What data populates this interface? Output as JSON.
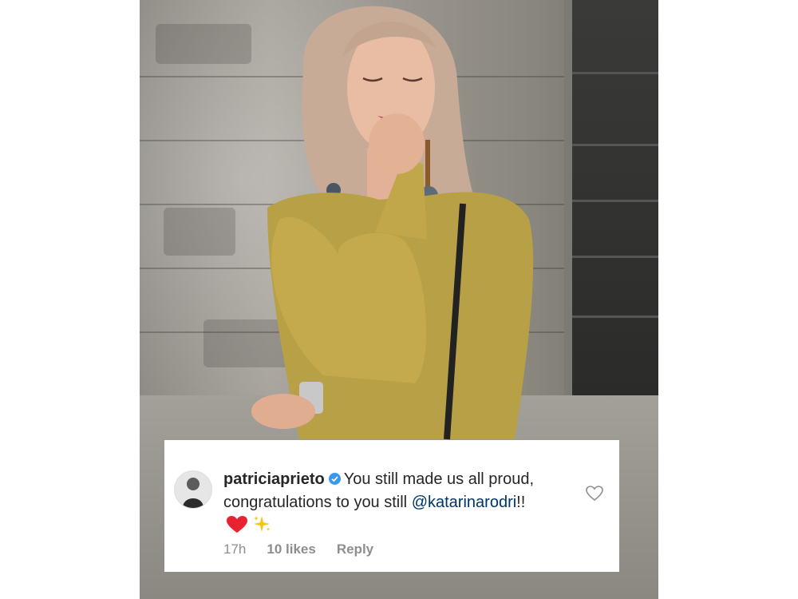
{
  "post": {
    "image_description_icon": "photo"
  },
  "comment": {
    "username": "patriciaprieto",
    "verified_icon": "verified-badge-icon",
    "text_part1": "You still made us all proud, congratulations to you still",
    "mention": "@katarinarodri",
    "text_suffix": "!!",
    "emoji_heart": "heart-emoji",
    "emoji_sparkles": "sparkles-emoji",
    "time": "17h",
    "likes": "10 likes",
    "reply_label": "Reply",
    "like_icon": "heart-outline-icon"
  },
  "colors": {
    "text": "#262626",
    "meta": "#8e8e8e",
    "mention": "#003569",
    "verified": "#3897f0",
    "heart": "#e8232f"
  }
}
